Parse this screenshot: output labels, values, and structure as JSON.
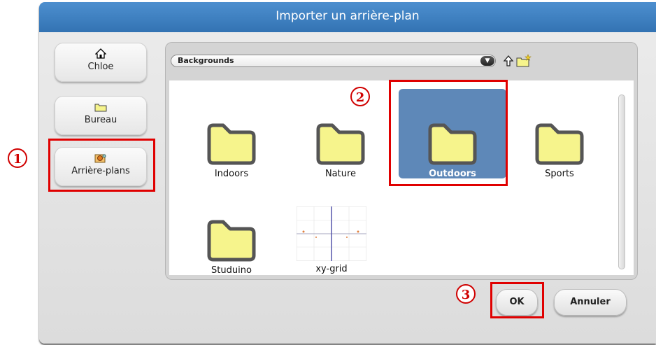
{
  "dialog": {
    "title": "Importer un arrière-plan"
  },
  "sidebar": {
    "items": [
      {
        "label": "Chloe",
        "icon": "home-icon"
      },
      {
        "label": "Bureau",
        "icon": "folder-icon"
      },
      {
        "label": "Arrière-plans",
        "icon": "backgrounds-icon"
      }
    ]
  },
  "browser": {
    "path": "Backgrounds",
    "dropdown_glyph": "▼",
    "files": [
      {
        "label": "Indoors",
        "type": "folder"
      },
      {
        "label": "Nature",
        "type": "folder"
      },
      {
        "label": "Outdoors",
        "type": "folder",
        "selected": true
      },
      {
        "label": "Sports",
        "type": "folder"
      },
      {
        "label": "Studuino",
        "type": "folder"
      },
      {
        "label": "xy-grid",
        "type": "image"
      }
    ]
  },
  "buttons": {
    "ok": "OK",
    "cancel": "Annuler"
  },
  "annotations": {
    "step1": "1",
    "step2": "2",
    "step3": "3"
  },
  "colors": {
    "highlight": "#e00000",
    "title_bar": "#3f80c1",
    "selection": "#5e88b8",
    "folder_fill": "#f6f48c"
  }
}
